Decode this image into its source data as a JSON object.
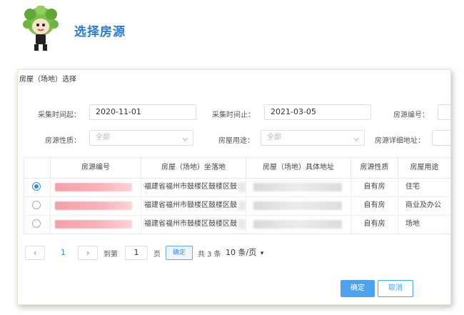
{
  "header": {
    "title": "选择房源"
  },
  "dialog": {
    "title": "房屋（场地）选择",
    "filters": {
      "start_label": "采集时间起：",
      "start_value": "2020-11-01",
      "end_label": "采集时间止：",
      "end_value": "2021-03-05",
      "code_label": "房源编号：",
      "code_value": "",
      "nature_label": "房源性质：",
      "nature_value": "全部",
      "use_label": "房屋用途：",
      "use_value": "全部",
      "address_label": "房源详细地址：",
      "address_value": ""
    },
    "table": {
      "columns": [
        "房源编号",
        "房屋（场地）坐落地",
        "房屋（场地）具体地址",
        "房源性质",
        "房屋用途"
      ],
      "rows": [
        {
          "selected": true,
          "location": "福建省福州市鼓楼区鼓楼区鼓",
          "nature": "自有房",
          "use": "住宅"
        },
        {
          "selected": false,
          "location": "福建省福州市鼓楼区鼓楼区鼓",
          "nature": "自有房",
          "use": "商业及办公"
        },
        {
          "selected": false,
          "location": "福建省福州市鼓楼区鼓楼区鼓",
          "nature": "自有房",
          "use": "场地"
        }
      ]
    },
    "pagination": {
      "prev": "‹",
      "current_page": "1",
      "next": "›",
      "goto_label": "到第",
      "goto_value": "1",
      "page_unit": "页",
      "confirm": "确定",
      "total": "共 3 条",
      "page_size": "10 条/页"
    },
    "buttons": {
      "ok": "确定",
      "cancel": "取消"
    }
  }
}
